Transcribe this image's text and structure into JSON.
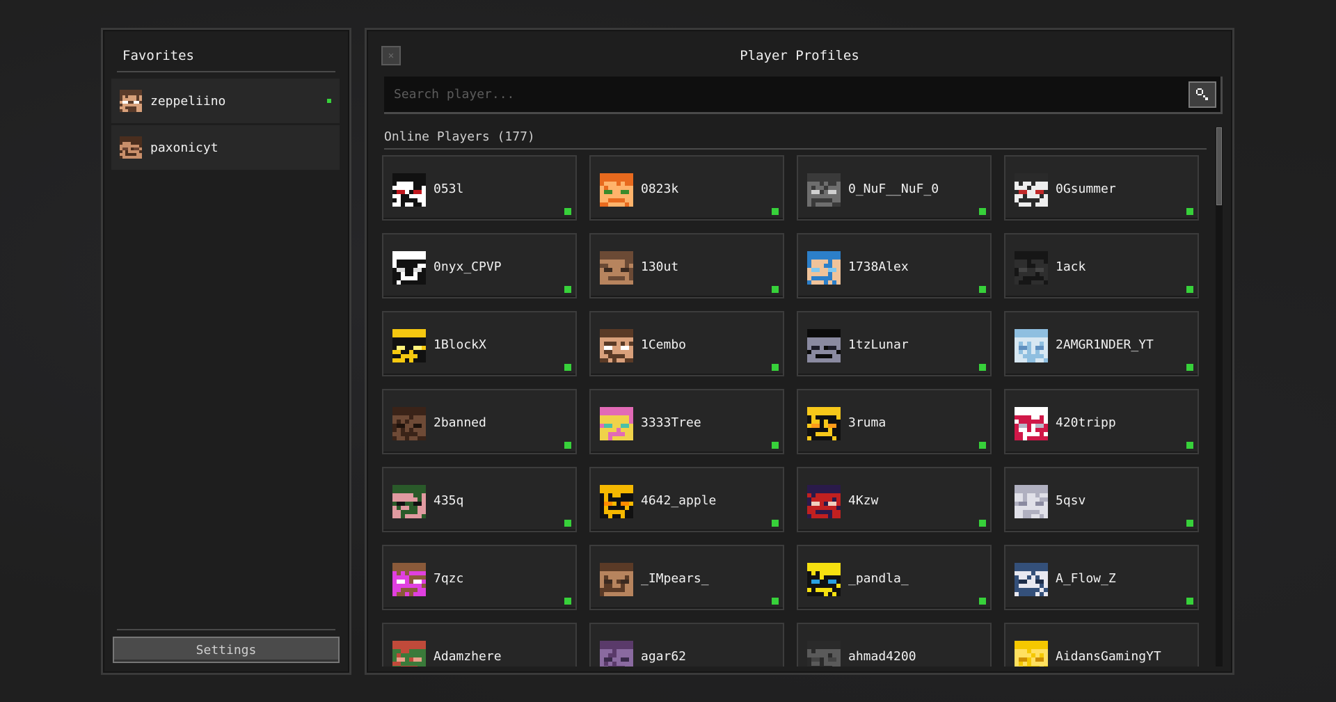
{
  "favorites": {
    "title": "Favorites",
    "items": [
      {
        "name": "zeppeliino",
        "online": true,
        "colors": [
          "#5a3b2a",
          "#d8a07a",
          "#ffffff"
        ]
      },
      {
        "name": "paxonicyt",
        "online": false,
        "colors": [
          "#4a2e1e",
          "#c98f6a",
          "#6b4432"
        ]
      }
    ],
    "settings_label": "Settings"
  },
  "profiles": {
    "title": "Player Profiles",
    "close_icon": "close-icon",
    "search": {
      "placeholder": "Search player...",
      "value": "",
      "icon": "magnifier-icon"
    },
    "section_label": "Online Players (177)",
    "players": [
      {
        "name": "053l",
        "online": true,
        "colors": [
          "#111111",
          "#ffffff",
          "#c0181e"
        ]
      },
      {
        "name": "0823k",
        "online": true,
        "colors": [
          "#e86a1e",
          "#ffb36b",
          "#3b8a2a"
        ]
      },
      {
        "name": "0_NuF__NuF_0",
        "online": true,
        "colors": [
          "#3a3a3a",
          "#6e6e6e",
          "#d0d0d0"
        ]
      },
      {
        "name": "0Gsummer",
        "online": true,
        "colors": [
          "#2a2a2a",
          "#eeeeee",
          "#c02828"
        ]
      },
      {
        "name": "0nyx_CPVP",
        "online": true,
        "colors": [
          "#ffffff",
          "#111111",
          "#dddddd"
        ]
      },
      {
        "name": "130ut",
        "online": true,
        "colors": [
          "#6b4a35",
          "#b7845e",
          "#3b2a20"
        ]
      },
      {
        "name": "1738Alex",
        "online": true,
        "colors": [
          "#2c7fc9",
          "#f0c39a",
          "#7fc8f0"
        ]
      },
      {
        "name": "1ack",
        "online": true,
        "colors": [
          "#161616",
          "#2e2e2e",
          "#444444"
        ]
      },
      {
        "name": "1BlockX",
        "online": true,
        "colors": [
          "#f5c810",
          "#111111",
          "#fff27a"
        ]
      },
      {
        "name": "1Cembo",
        "online": true,
        "colors": [
          "#5a3a26",
          "#d9a07b",
          "#ffffff"
        ]
      },
      {
        "name": "1tzLunar",
        "online": true,
        "colors": [
          "#0b0b0b",
          "#8a8aa0",
          "#1e1e2a"
        ]
      },
      {
        "name": "2AMGR1NDER_YT",
        "online": true,
        "colors": [
          "#8fbfe0",
          "#d7e7f2",
          "#5f8fbf"
        ]
      },
      {
        "name": "2banned",
        "online": true,
        "colors": [
          "#3a2318",
          "#6e4a36",
          "#1e120c"
        ]
      },
      {
        "name": "3333Tree",
        "online": true,
        "colors": [
          "#e26ab6",
          "#f0d24a",
          "#4ac0a8"
        ]
      },
      {
        "name": "3ruma",
        "online": true,
        "colors": [
          "#f7c81a",
          "#111111",
          "#ff9a1a"
        ]
      },
      {
        "name": "420tripp",
        "online": true,
        "colors": [
          "#ffffff",
          "#d01848",
          "#b8b8c8"
        ]
      },
      {
        "name": "435q",
        "online": true,
        "colors": [
          "#2a5a2a",
          "#e09aa0",
          "#111111"
        ]
      },
      {
        "name": "4642_apple",
        "online": true,
        "colors": [
          "#f5b800",
          "#111111",
          "#ff8a00"
        ]
      },
      {
        "name": "4Kzw",
        "online": true,
        "colors": [
          "#2a1a4a",
          "#c02020",
          "#f0d0c0"
        ]
      },
      {
        "name": "5qsv",
        "online": true,
        "colors": [
          "#b0b0c0",
          "#e0e0e8",
          "#8a8aa0"
        ]
      },
      {
        "name": "7qzc",
        "online": true,
        "colors": [
          "#8a5a3a",
          "#e040e0",
          "#ffffff"
        ]
      },
      {
        "name": "_IMpears_",
        "online": true,
        "colors": [
          "#5a3a26",
          "#b7845e",
          "#3b2a20"
        ]
      },
      {
        "name": "_pandla_",
        "online": true,
        "colors": [
          "#f5e010",
          "#111111",
          "#2aa0e0"
        ]
      },
      {
        "name": "A_Flow_Z",
        "online": true,
        "colors": [
          "#34507a",
          "#e8e8f0",
          "#1e2e4a"
        ]
      },
      {
        "name": "Adamzhere",
        "online": true,
        "colors": [
          "#c04a3a",
          "#3a7a3a",
          "#e8a08a"
        ]
      },
      {
        "name": "agar62",
        "online": true,
        "colors": [
          "#5a3a6a",
          "#8a6aa0",
          "#3a2a4a"
        ]
      },
      {
        "name": "ahmad4200",
        "online": true,
        "colors": [
          "#2a2a2a",
          "#5a5a5a",
          "#444444"
        ]
      },
      {
        "name": "AidansGamingYT",
        "online": true,
        "colors": [
          "#f5c800",
          "#ffe060",
          "#d09000"
        ]
      }
    ]
  }
}
